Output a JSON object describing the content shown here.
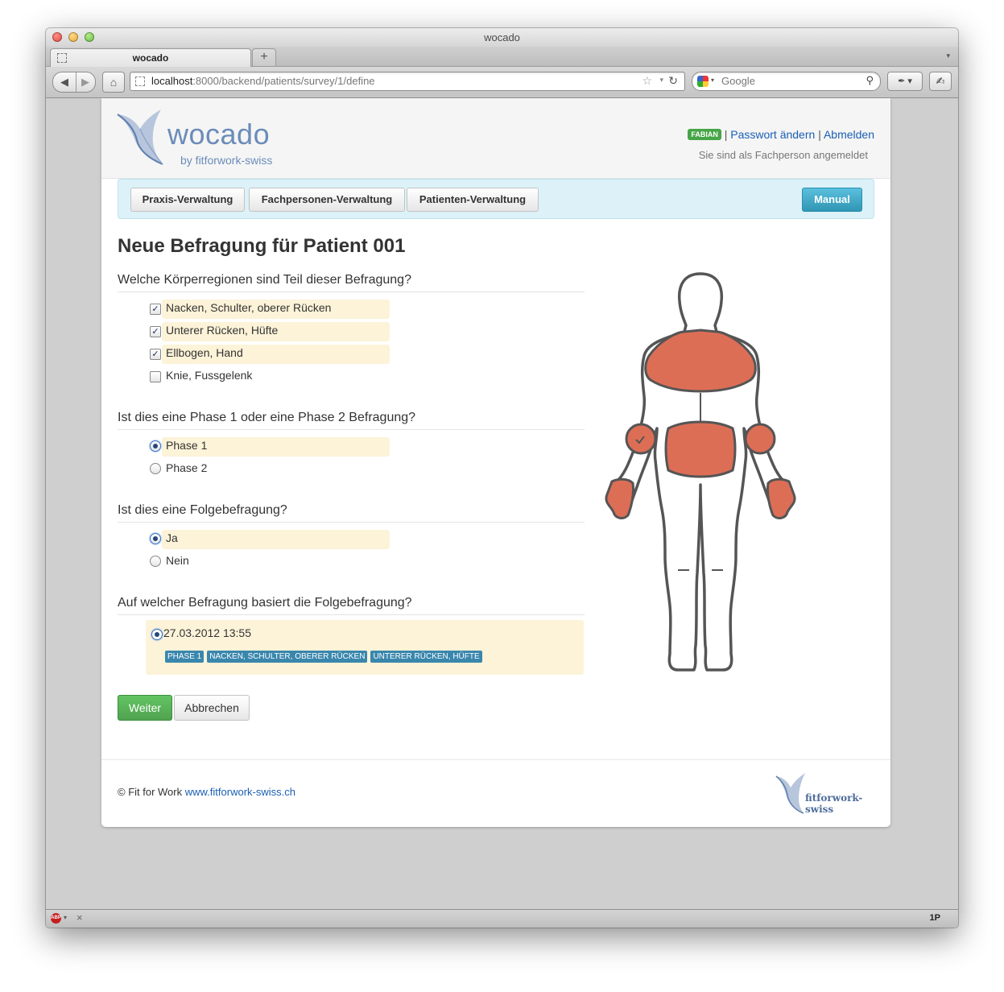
{
  "window": {
    "title": "wocado"
  },
  "tab": {
    "label": "wocado",
    "new_tab": "+"
  },
  "address": {
    "host": "localhost",
    "path": ":8000/backend/patients/survey/1/define"
  },
  "search": {
    "placeholder": "Google"
  },
  "header": {
    "logo_text": "wocado",
    "logo_sub": "by fitforwork-swiss",
    "user_badge": "FABIAN",
    "sep1": "|",
    "change_password": "Passwort ändern",
    "sep2": "|",
    "logout": "Abmelden",
    "login_info": "Sie sind als Fachperson angemeldet"
  },
  "nav": {
    "items": [
      "Praxis-Verwaltung",
      "Fachpersonen-Verwaltung",
      "Patienten-Verwaltung"
    ],
    "manual": "Manual"
  },
  "page_title": "Neue Befragung für Patient 001",
  "questions": {
    "regions": {
      "legend": "Welche Körperregionen sind Teil dieser Befragung?",
      "options": [
        {
          "label": "Nacken, Schulter, oberer Rücken",
          "checked": true
        },
        {
          "label": "Unterer Rücken, Hüfte",
          "checked": true
        },
        {
          "label": "Ellbogen, Hand",
          "checked": true
        },
        {
          "label": "Knie, Fussgelenk",
          "checked": false
        }
      ]
    },
    "phase": {
      "legend": "Ist dies eine Phase 1 oder eine Phase 2 Befragung?",
      "options": [
        {
          "label": "Phase 1",
          "selected": true
        },
        {
          "label": "Phase 2",
          "selected": false
        }
      ]
    },
    "followup": {
      "legend": "Ist dies eine Folgebefragung?",
      "options": [
        {
          "label": "Ja",
          "selected": true
        },
        {
          "label": "Nein",
          "selected": false
        }
      ]
    },
    "basis": {
      "legend": "Auf welcher Befragung basiert die Folgebefragung?",
      "date": "27.03.2012 13:55",
      "tags": [
        "PHASE 1",
        "NACKEN, SCHULTER, OBERER RÜCKEN",
        "UNTERER RÜCKEN, HÜFTE"
      ]
    }
  },
  "buttons": {
    "next": "Weiter",
    "cancel": "Abbrechen"
  },
  "footer": {
    "copyright": "© Fit for Work ",
    "link": "www.fitforwork-swiss.ch",
    "logo_text": "fitforwork-swiss"
  },
  "body_figure": {
    "highlight_color": "#dd6e56",
    "outline_color": "#555555"
  },
  "statusbar": {
    "abp": "ABP",
    "onep": "1P"
  },
  "icons": {
    "back": "◀",
    "forward": "▶",
    "home": "⌂",
    "star": "☆",
    "dropdown": "▾",
    "reload": "↻",
    "search": "⚲",
    "close": "×",
    "check": "✓"
  }
}
